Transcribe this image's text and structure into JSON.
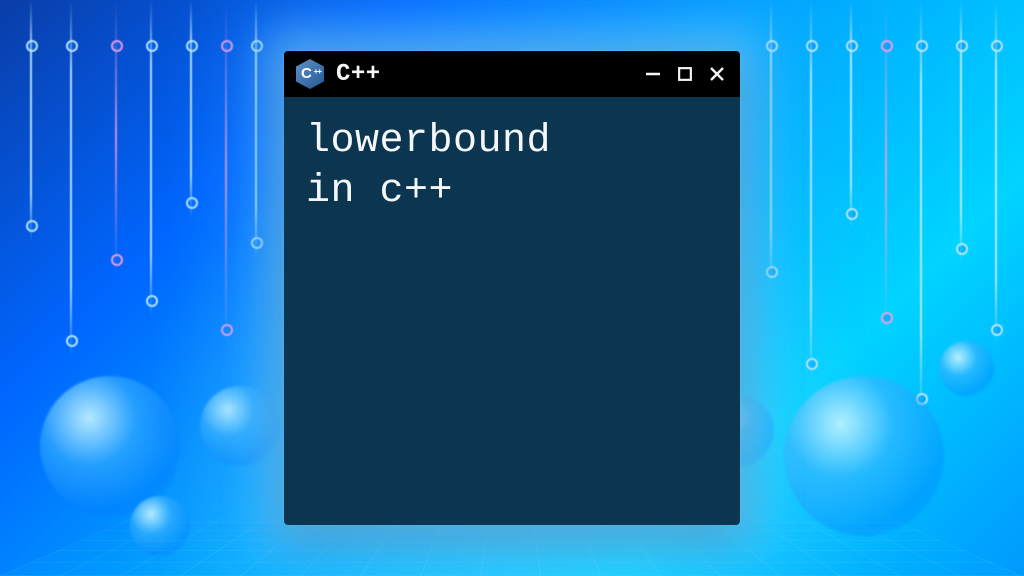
{
  "window": {
    "title": "C++",
    "icon_name": "cpp-logo-icon"
  },
  "content": {
    "lines": "lowerbound\nin c++"
  },
  "colors": {
    "titlebar_bg": "#000000",
    "client_bg": "#0c3550",
    "text": "#f4f7f9",
    "glow": "#78d2ff"
  }
}
